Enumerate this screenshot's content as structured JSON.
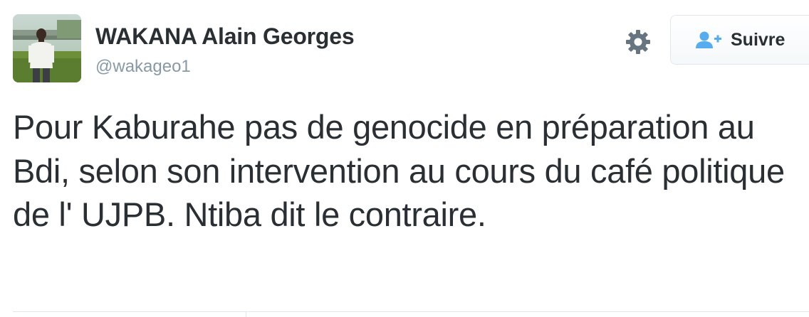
{
  "tweet": {
    "author": {
      "display_name": "WAKANA Alain Georges",
      "handle": "@wakageo1",
      "avatar_icon": "profile-photo"
    },
    "actions": {
      "settings_icon": "gear-icon",
      "follow_icon": "add-user-icon",
      "follow_label": "Suivre"
    },
    "text": "Pour Kaburahe pas de genocide en préparation au Bdi, selon son intervention au cours du café politique de l' UJPB. Ntiba dit le contraire."
  },
  "colors": {
    "name": "#292f33",
    "handle": "#8899a6",
    "gear": "#66757f",
    "follow_icon": "#55acee",
    "divider": "#e1e8ed"
  }
}
